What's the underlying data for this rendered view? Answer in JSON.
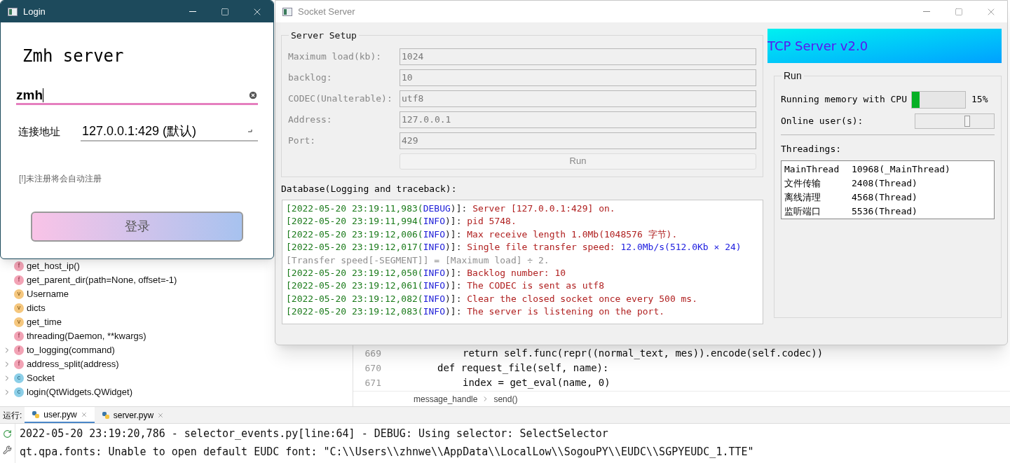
{
  "ide": {
    "structure": [
      {
        "label": "get_host_ip()",
        "kind": "function",
        "badge": "f",
        "expandable": false
      },
      {
        "label": "get_parent_dir(path=None, offset=-1)",
        "kind": "function",
        "badge": "f",
        "expandable": false
      },
      {
        "label": "Username",
        "kind": "variable",
        "badge": "v",
        "expandable": false
      },
      {
        "label": "dicts",
        "kind": "variable",
        "badge": "v",
        "expandable": false
      },
      {
        "label": "get_time",
        "kind": "variable",
        "badge": "v",
        "expandable": false
      },
      {
        "label": "threading(Daemon, **kwargs)",
        "kind": "function",
        "badge": "f",
        "expandable": false
      },
      {
        "label": "to_logging(command)",
        "kind": "function",
        "badge": "f",
        "expandable": true
      },
      {
        "label": "address_split(address)",
        "kind": "function",
        "badge": "f",
        "expandable": true
      },
      {
        "label": "Socket",
        "kind": "class",
        "badge": "c",
        "expandable": true
      },
      {
        "label": "login(QtWidgets.QWidget)",
        "kind": "class",
        "badge": "c",
        "expandable": true
      }
    ],
    "editor": {
      "lines": [
        {
          "number": "669",
          "kind": "body",
          "code": "return self.func(repr((normal_text, mes)).encode(self.codec))"
        },
        {
          "number": "670",
          "kind": "def",
          "code": "def request_file(self, name):"
        },
        {
          "number": "671",
          "kind": "body",
          "code": "index = get_eval(name, 0)"
        }
      ],
      "breadcrumb": [
        "message_handle",
        "send()"
      ]
    },
    "run_panel": {
      "label": "运行:",
      "tabs": [
        {
          "label": "user.pyw",
          "selected": true
        },
        {
          "label": "server.pyw",
          "selected": false
        }
      ],
      "console": [
        "2022-05-20 23:19:20,786 - selector_events.py[line:64] - DEBUG: Using selector: SelectSelector",
        "qt.qpa.fonts: Unable to open default EUDC font: \"C:\\\\Users\\\\zhnwe\\\\AppData\\\\LocalLow\\\\SogouPY\\\\EUDC\\\\SGPYEUDC_1.TTE\""
      ]
    }
  },
  "login_window": {
    "title": "Login",
    "active": true,
    "heading": "Zmh server",
    "username": {
      "value": "zmh"
    },
    "address": {
      "label": "连接地址",
      "value": "127.0.0.1:429 (默认)"
    },
    "note": "[!]未注册将会自动注册",
    "button": "登录"
  },
  "server_window": {
    "title": "Socket Server",
    "active": false,
    "setup": {
      "title": "Server Setup",
      "fields": [
        {
          "label": "Maximum load(kb):",
          "value": "1024",
          "disabled": true
        },
        {
          "label": "backlog:",
          "value": "10",
          "disabled": true
        },
        {
          "label": "CODEC(Unalterable):",
          "value": "utf8",
          "disabled": true
        },
        {
          "label": "Address:",
          "value": "127.0.0.1",
          "disabled": true
        },
        {
          "label": "Port:",
          "value": "429",
          "disabled": true
        }
      ],
      "run_button": {
        "label": "Run",
        "disabled": true
      }
    },
    "log": {
      "title": "Database(Logging and traceback):",
      "lines": [
        {
          "segments": [
            {
              "kind": "time",
              "text": "[2022-05-20 23:19:11,983("
            },
            {
              "kind": "level",
              "text": "DEBUG"
            },
            {
              "kind": "sep",
              "text": ")]: "
            },
            {
              "kind": "message",
              "text": "Server [127.0.0.1:429] on."
            }
          ]
        },
        {
          "segments": [
            {
              "kind": "time",
              "text": "[2022-05-20 23:19:11,994("
            },
            {
              "kind": "level",
              "text": "INFO"
            },
            {
              "kind": "sep",
              "text": ")]: "
            },
            {
              "kind": "message",
              "text": "pid 5748."
            }
          ]
        },
        {
          "segments": [
            {
              "kind": "time",
              "text": "[2022-05-20 23:19:12,006("
            },
            {
              "kind": "level",
              "text": "INFO"
            },
            {
              "kind": "sep",
              "text": ")]: "
            },
            {
              "kind": "message",
              "text": "Max receive length 1.0Mb(1048576 字节)."
            }
          ]
        },
        {
          "segments": [
            {
              "kind": "time",
              "text": "[2022-05-20 23:19:12,017("
            },
            {
              "kind": "level",
              "text": "INFO"
            },
            {
              "kind": "sep",
              "text": ")]: "
            },
            {
              "kind": "message",
              "text": "Single file transfer speed: "
            },
            {
              "kind": "value",
              "text": "12.0Mb/s(512.0Kb × 24)"
            }
          ]
        },
        {
          "segments": [
            {
              "kind": "note",
              "text": "[Transfer speed[-SEGMENT]] = [Maximum load] ÷ 2."
            }
          ]
        },
        {
          "segments": [
            {
              "kind": "time",
              "text": "[2022-05-20 23:19:12,050("
            },
            {
              "kind": "level",
              "text": "INFO"
            },
            {
              "kind": "sep",
              "text": ")]: "
            },
            {
              "kind": "message",
              "text": "Backlog number: 10"
            }
          ]
        },
        {
          "segments": [
            {
              "kind": "time",
              "text": "[2022-05-20 23:19:12,061("
            },
            {
              "kind": "level",
              "text": "INFO"
            },
            {
              "kind": "sep",
              "text": ")]: "
            },
            {
              "kind": "message",
              "text": "The CODEC is sent as utf8"
            }
          ]
        },
        {
          "segments": [
            {
              "kind": "time",
              "text": "[2022-05-20 23:19:12,082("
            },
            {
              "kind": "level",
              "text": "INFO"
            },
            {
              "kind": "sep",
              "text": ")]: "
            },
            {
              "kind": "message",
              "text": "Clear the closed socket once every 500 ms."
            }
          ]
        },
        {
          "segments": [
            {
              "kind": "time",
              "text": "[2022-05-20 23:19:12,083("
            },
            {
              "kind": "level",
              "text": "INFO"
            },
            {
              "kind": "sep",
              "text": ")]: "
            },
            {
              "kind": "message",
              "text": "The server is listening on the port."
            }
          ]
        }
      ]
    },
    "banner": "TCP Server v2.0",
    "run": {
      "title": "Run",
      "memory": {
        "label": "Running memory with CPU",
        "level": 0.15,
        "reading": "15%"
      },
      "users": {
        "label": "Online user(s):",
        "level": 0.66
      },
      "threads_title": "Threadings:",
      "threads": [
        {
          "name": "MainThread",
          "id": "10968(_MainThread)"
        },
        {
          "name": "文件传输",
          "id": "2408(Thread)"
        },
        {
          "name": "离线清理",
          "id": "4568(Thread)"
        },
        {
          "name": "监听端口",
          "id": "5536(Thread)"
        }
      ]
    }
  }
}
